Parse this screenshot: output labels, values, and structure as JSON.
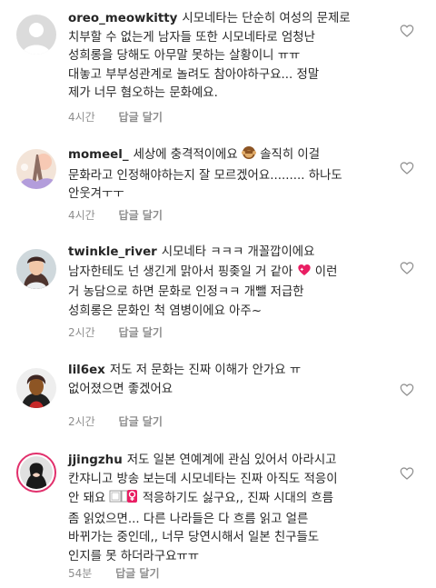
{
  "comments": [
    {
      "username": "oreo_meowkitty",
      "lines": [
        "시모네타는 단순히 여성의 문제로",
        "치부할 수 없는게 남자들 또한 시모네타로 엄청난",
        "성희롱을 당해도 아무말 못하는 살황이니 ㅠㅠ",
        "대놓고 부부성관계로 놀려도 참아야하구요... 정말",
        "제가 너무 혐오하는 문화예요."
      ],
      "time": "4시간",
      "reply_label": "답글 달기",
      "avatar_icon": "default-avatar-icon"
    },
    {
      "username": "momeel_",
      "lines": [
        "세상에 충격적이에요 [monkey-emoji] 솔직히 이걸",
        "문화라고 인정해야하는지 잘 모르겠어요......... 하나도",
        "안웃겨ㅜㅜ"
      ],
      "time": "4시간",
      "reply_label": "답글 달기",
      "avatar_icon": "eiffel-tower-avatar-icon"
    },
    {
      "username": "twinkle_river",
      "lines": [
        "시모네타 ㅋㅋㅋ 개꼴깝이에요",
        "남자한테도 넌 생긴게 맑아서 핑좆일 거 같아 [heart-emoji] 이런",
        "거 농담으로 하면 문화로 인정ㅋㅋ 개뺄 저급한",
        "성희롱은 문화인 척 염병이에요 아주~"
      ],
      "time": "2시간",
      "reply_label": "답글 달기",
      "avatar_icon": "person-photo-avatar-icon"
    },
    {
      "username": "lil6ex",
      "lines": [
        "저도 저 문화는 진짜 이해가 안가요 ㅠ",
        "없어졌으면 좋겠어요"
      ],
      "time": "2시간",
      "reply_label": "답글 달기",
      "avatar_icon": "person-photo-avatar-icon"
    },
    {
      "username": "jjingzhu",
      "lines": [
        "저도 일본 연예계에 관심 있어서 아라시고",
        "칸쟈니고 방송 보는데 시모네타는 진짜 아직도 적응이",
        "안 돼요 [woman-shrug-emoji] 적응하기도 싫구요,, 진짜 시대의 흐름",
        "좀 읽었으면... 다른 나라들은 다 흐름 읽고 얼른",
        "바뀌가는 중인데,, 너무 당연시해서 일본 친구들도",
        "인지를 못 하더라구요ㅠㅠ"
      ],
      "time": "54분",
      "reply_label": "답글 달기",
      "avatar_icon": "story-ring-avatar-icon"
    }
  ]
}
